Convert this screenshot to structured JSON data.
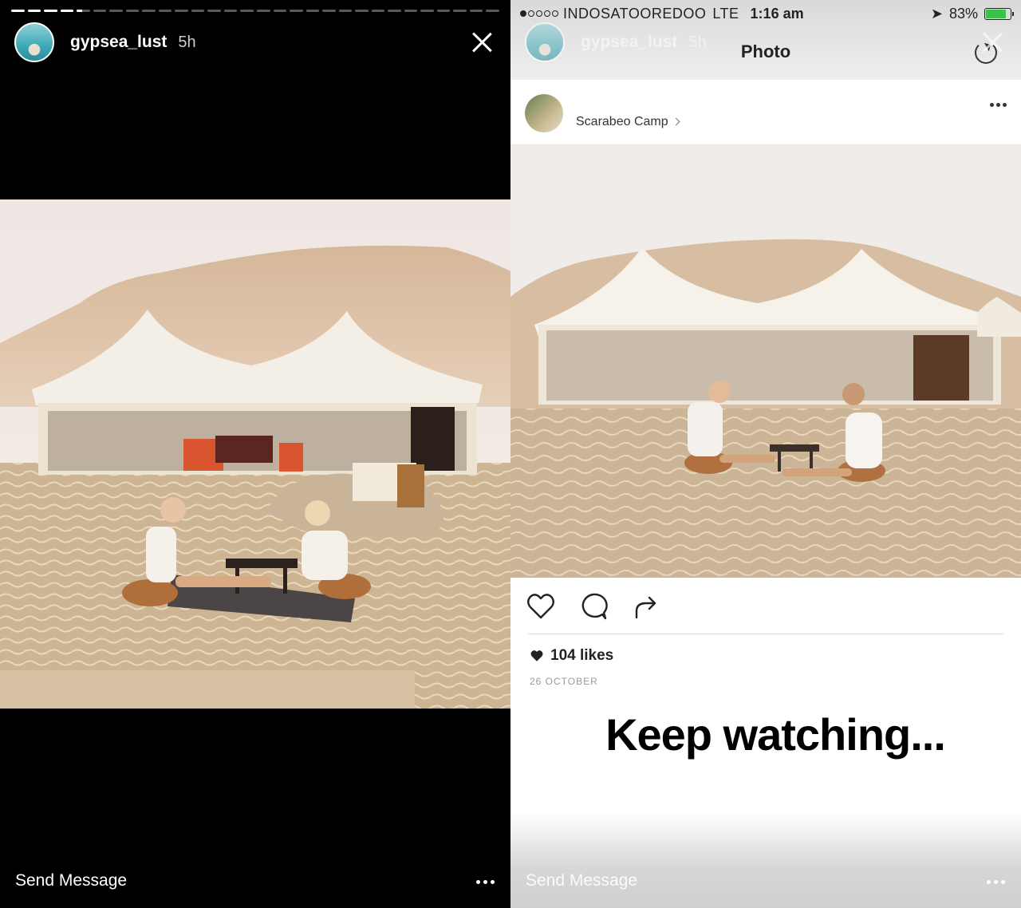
{
  "left_story": {
    "username": "gypsea_lust",
    "time": "5h",
    "send_message": "Send Message",
    "progress_segments": [
      1,
      1,
      1,
      1,
      0.4,
      0,
      0,
      0,
      0,
      0,
      0,
      0,
      0,
      0,
      0,
      0,
      0,
      0,
      0,
      0,
      0,
      0,
      0,
      0,
      0,
      0,
      0,
      0,
      0,
      0
    ]
  },
  "right_story": {
    "status_bar": {
      "carrier": "INDOSATOOREDOO",
      "network": "LTE",
      "time": "1:16 am",
      "battery": "83%",
      "battery_level": 0.83
    },
    "username": "gypsea_lust",
    "time": "5h",
    "nav_title": "Photo",
    "post": {
      "location": "Scarabeo Camp",
      "likes": "104 likes",
      "date": "26 OCTOBER"
    },
    "overlay_text": "Keep watching...",
    "send_message": "Send Message"
  },
  "colors": {
    "story_bg": "#000000",
    "battery_green": "#3cc24a",
    "sand": "#d9c3a0",
    "tent": "#f4efe6"
  }
}
